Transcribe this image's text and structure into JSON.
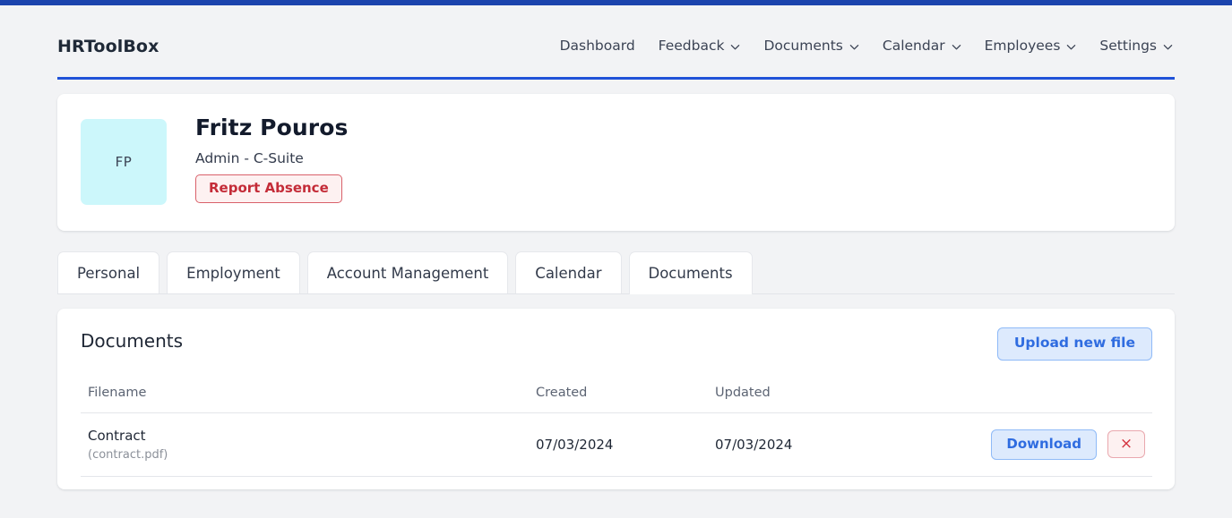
{
  "brand": "HRToolBox",
  "nav": {
    "items": [
      {
        "label": "Dashboard",
        "has_chevron": false
      },
      {
        "label": "Feedback",
        "has_chevron": true
      },
      {
        "label": "Documents",
        "has_chevron": true
      },
      {
        "label": "Calendar",
        "has_chevron": true
      },
      {
        "label": "Employees",
        "has_chevron": true
      },
      {
        "label": "Settings",
        "has_chevron": true
      }
    ]
  },
  "profile": {
    "initials": "FP",
    "name": "Fritz Pouros",
    "role": "Admin - C-Suite",
    "report_absence_label": "Report Absence"
  },
  "tabs": [
    {
      "label": "Personal",
      "active": false
    },
    {
      "label": "Employment",
      "active": false
    },
    {
      "label": "Account Management",
      "active": false
    },
    {
      "label": "Calendar",
      "active": false
    },
    {
      "label": "Documents",
      "active": true
    }
  ],
  "documents_panel": {
    "title": "Documents",
    "upload_label": "Upload new file",
    "columns": {
      "filename": "Filename",
      "created": "Created",
      "updated": "Updated"
    },
    "rows": [
      {
        "name": "Contract",
        "file": "(contract.pdf)",
        "created": "07/03/2024",
        "updated": "07/03/2024",
        "download_label": "Download",
        "delete_label": "×"
      }
    ]
  },
  "colors": {
    "top_accent": "#1b44ad",
    "header_underline": "#2052d8",
    "page_bg": "#f2f3f5",
    "avatar_bg": "#ccf7fb",
    "danger": "#c42c38",
    "primary": "#2f6ce0"
  }
}
